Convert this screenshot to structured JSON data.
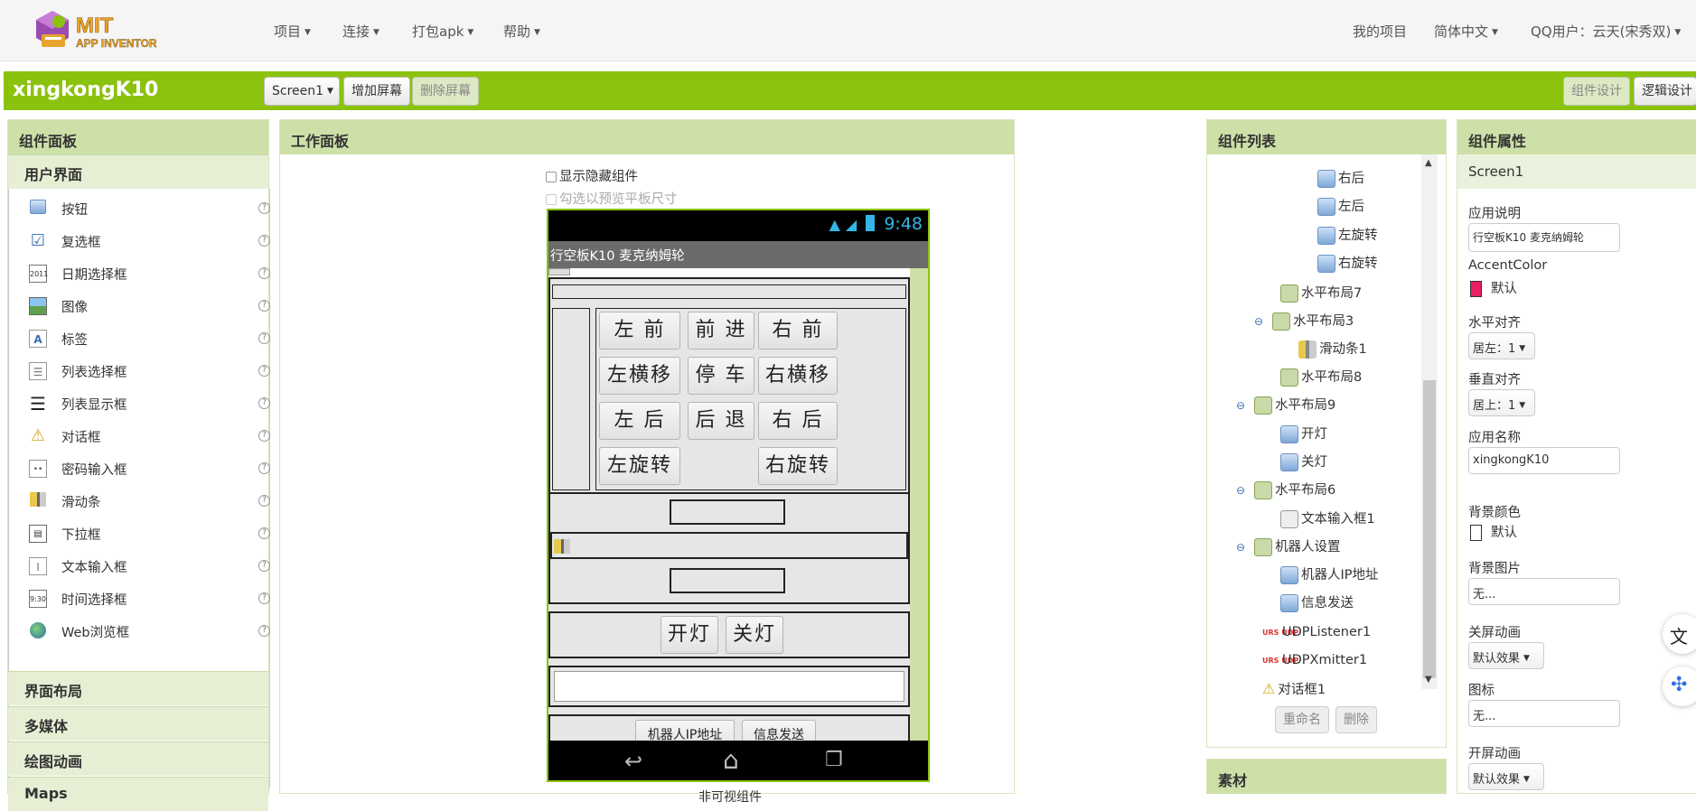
{
  "header": {
    "menus": [
      "项目",
      "连接",
      "打包apk",
      "帮助"
    ],
    "right": {
      "my_projects": "我的项目",
      "language": "简体中文",
      "user": "QQ用户：云天(宋秀双)"
    }
  },
  "project_bar": {
    "title": "xingkongK10",
    "screen_select": "Screen1",
    "add_screen": "增加屏幕",
    "remove_screen": "删除屏幕",
    "designer": "组件设计",
    "blocks": "逻辑设计"
  },
  "palette": {
    "title": "组件面板",
    "category": "用户界面",
    "items": [
      {
        "label": "按钮",
        "icon": "button-icon"
      },
      {
        "label": "复选框",
        "icon": "checkbox-icon"
      },
      {
        "label": "日期选择框",
        "icon": "date-picker-icon"
      },
      {
        "label": "图像",
        "icon": "image-icon"
      },
      {
        "label": "标签",
        "icon": "label-icon"
      },
      {
        "label": "列表选择框",
        "icon": "list-picker-icon"
      },
      {
        "label": "列表显示框",
        "icon": "list-view-icon"
      },
      {
        "label": "对话框",
        "icon": "notifier-icon"
      },
      {
        "label": "密码输入框",
        "icon": "password-icon"
      },
      {
        "label": "滑动条",
        "icon": "slider-icon"
      },
      {
        "label": "下拉框",
        "icon": "spinner-icon"
      },
      {
        "label": "文本输入框",
        "icon": "textbox-icon"
      },
      {
        "label": "时间选择框",
        "icon": "time-picker-icon"
      },
      {
        "label": "Web浏览框",
        "icon": "web-viewer-icon"
      }
    ],
    "help_glyph": "?",
    "sections": [
      "界面布局",
      "多媒体",
      "绘图动画",
      "Maps"
    ]
  },
  "viewer": {
    "title": "工作面板",
    "show_hidden": "显示隐藏组件",
    "tablet_preview": "勾选以预览平板尺寸",
    "status_time": "9:48",
    "app_title": "行空板K10 麦克纳姆轮",
    "buttons_grid": [
      [
        "左 前",
        "前 进",
        "右 前"
      ],
      [
        "左横移",
        "停 车",
        "右横移"
      ],
      [
        "左 后",
        "后 退",
        "右 后"
      ],
      [
        "左旋转",
        "",
        "右旋转"
      ]
    ],
    "light_on": "开灯",
    "light_off": "关灯",
    "robot_ip": "机器人IP地址",
    "send_info": "信息发送",
    "nonvisible": "非可视组件"
  },
  "tree": {
    "title": "组件列表",
    "nodes": [
      {
        "label": "右后",
        "icon": "button-icon"
      },
      {
        "label": "左后",
        "icon": "button-icon"
      },
      {
        "label": "左旋转",
        "icon": "button-icon"
      },
      {
        "label": "右旋转",
        "icon": "button-icon"
      },
      {
        "label": "水平布局7",
        "icon": "horizontal-arrangement-icon"
      },
      {
        "label": "水平布局3",
        "icon": "horizontal-arrangement-icon"
      },
      {
        "label": "滑动条1",
        "icon": "slider-icon"
      },
      {
        "label": "水平布局8",
        "icon": "horizontal-arrangement-icon"
      },
      {
        "label": "水平布局9",
        "icon": "horizontal-arrangement-icon"
      },
      {
        "label": "开灯",
        "icon": "button-icon"
      },
      {
        "label": "关灯",
        "icon": "button-icon"
      },
      {
        "label": "水平布局6",
        "icon": "horizontal-arrangement-icon"
      },
      {
        "label": "文本输入框1",
        "icon": "textbox-icon"
      },
      {
        "label": "机器人设置",
        "icon": "horizontal-arrangement-icon"
      },
      {
        "label": "机器人IP地址",
        "icon": "button-icon"
      },
      {
        "label": "信息发送",
        "icon": "button-icon"
      },
      {
        "label": "UDPListener1",
        "icon": "udp-icon"
      },
      {
        "label": "UDPXmitter1",
        "icon": "udp-icon"
      },
      {
        "label": "对话框1",
        "icon": "notifier-icon"
      }
    ],
    "udp_glyph": "URS UDP",
    "collapse_glyph": "⊖",
    "rename": "重命名",
    "delete": "删除",
    "media_title": "素材"
  },
  "properties": {
    "title": "组件属性",
    "component": "Screen1",
    "about_label": "应用说明",
    "about_value": "行空板K10 麦克纳姆轮",
    "accent_label": "AccentColor",
    "accent_value": "默认",
    "accent_color": "#e91e63",
    "halign_label": "水平对齐",
    "halign_value": "居左：1",
    "valign_label": "垂直对齐",
    "valign_value": "居上：1",
    "appname_label": "应用名称",
    "appname_value": "xingkongK10",
    "bgcolor_label": "背景颜色",
    "bgcolor_value": "默认",
    "bgimage_label": "背景图片",
    "bgimage_value": "无...",
    "close_anim_label": "关屏动画",
    "close_anim_value": "默认效果",
    "icon_label": "图标",
    "icon_value": "无...",
    "open_anim_label": "开屏动画",
    "open_anim_value": "默认效果"
  },
  "logo": {
    "text_top": "MIT",
    "text_bottom": "APP INVENTOR"
  }
}
